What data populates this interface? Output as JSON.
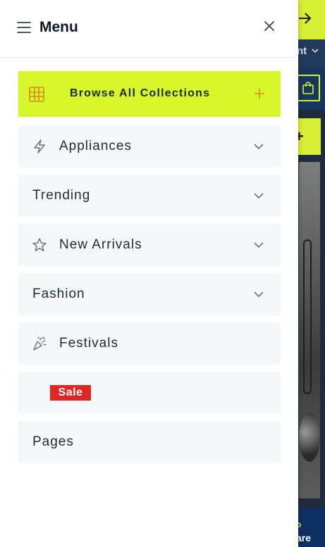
{
  "background": {
    "nav_text": "nt",
    "bottom_text_top": "o",
    "bottom_text": "are"
  },
  "menu": {
    "title": "Menu",
    "browse_label": "Browse All Collections",
    "items": [
      {
        "label": "Appliances",
        "icon": "lightning-icon",
        "has_chevron": true
      },
      {
        "label": "Trending",
        "icon": "",
        "has_chevron": true
      },
      {
        "label": "New Arrivals",
        "icon": "star-icon",
        "has_chevron": true
      },
      {
        "label": "Fashion",
        "icon": "",
        "has_chevron": true
      },
      {
        "label": "Festivals",
        "icon": "party-popper-icon",
        "has_chevron": false
      },
      {
        "label": "",
        "icon": "",
        "has_chevron": false,
        "badge": "Sale"
      },
      {
        "label": "Pages",
        "icon": "",
        "has_chevron": false
      }
    ]
  },
  "colors": {
    "accent": "#d7f72b",
    "sale": "#e02525",
    "item_bg": "#f6f7f9",
    "icon_orange": "#d98b1c"
  }
}
